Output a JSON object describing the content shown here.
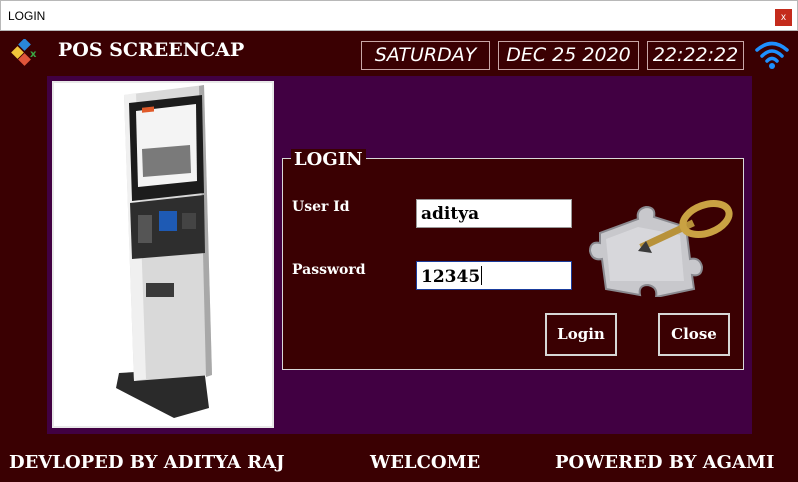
{
  "window": {
    "title": "LOGIN",
    "close_label": "x"
  },
  "header": {
    "app_title": "POS SCREENCAP",
    "day": "SATURDAY",
    "date": "DEC 25 2020",
    "time": "22:22:22"
  },
  "login": {
    "legend": "LOGIN",
    "userid_label": "User Id",
    "userid_value": "aditya",
    "password_label": "Password",
    "password_value": "12345",
    "login_button": "Login",
    "close_button": "Close"
  },
  "footer": {
    "developer": "DEVLOPED BY ADITYA RAJ",
    "welcome": "WELCOME",
    "powered": "POWERED BY AGAMI"
  },
  "colors": {
    "background": "#3a0002",
    "panel": "#410042",
    "close_button": "#c42b1c"
  },
  "icons": [
    "app-logo-icon",
    "wifi-icon",
    "kiosk-image",
    "puzzle-key-icon"
  ]
}
